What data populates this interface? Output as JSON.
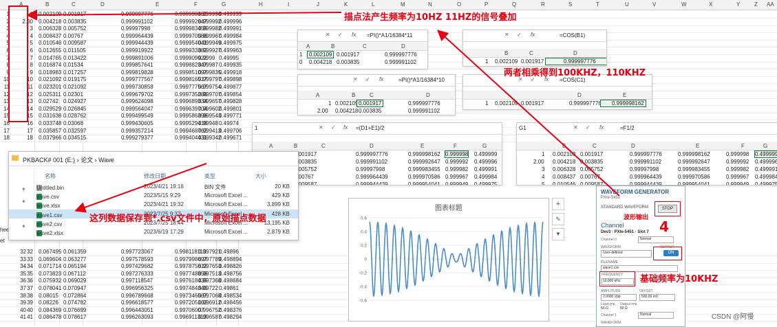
{
  "sheet": {
    "columns": [
      "A",
      "B",
      "C",
      "D",
      "E",
      "F",
      "G",
      "H",
      "I",
      "J",
      "K",
      "L",
      "M",
      "N",
      "O",
      "P",
      "Q",
      "R",
      "S",
      "T",
      "U",
      "V",
      "W",
      "X",
      "Y",
      "Z",
      "AA"
    ],
    "rows_top": [
      {
        "n": "1",
        "a": "1",
        "b": "0.002109",
        "c": "0.001917",
        "d": "0.999997776",
        "e": "0.999998162",
        "f": "0.999998",
        "g": "0.499999"
      },
      {
        "n": "2",
        "a": "2.00",
        "b": "0.004218",
        "c": "0.003835",
        "d": "0.999991102",
        "e": "0.999992647",
        "f": "0.999992",
        "g": "0.499996"
      },
      {
        "n": "3",
        "a": "3",
        "b": "0.006328",
        "c": "0.005752",
        "d": "0.99997998",
        "e": "0.999983455",
        "f": "0.999982",
        "g": "0.499991"
      },
      {
        "n": "4",
        "a": "4",
        "b": "0.008437",
        "c": "0.00767",
        "d": "0.999964439",
        "e": "0.999970586",
        "f": "0.999967",
        "g": "0.499984"
      },
      {
        "n": "5",
        "a": "5",
        "b": "0.010546",
        "c": "0.009587",
        "d": "0.999944439",
        "e": "0.999954041",
        "f": "0.999949",
        "g": "0.499975"
      },
      {
        "n": "6",
        "a": "6",
        "b": "0.012655",
        "c": "0.011505",
        "d": "0.999919922",
        "e": "0.999933382",
        "f": "0.999927",
        "g": "0.499963"
      },
      {
        "n": "7",
        "a": "7",
        "b": "0.014765",
        "c": "0.013422",
        "d": "0.999891006",
        "e": "0.999909922",
        "f": "0.9999",
        "g": "0.49995"
      },
      {
        "n": "8",
        "a": "8",
        "b": "0.016874",
        "c": "0.01534",
        "d": "0.999857641",
        "e": "0.999882347",
        "f": "0.99987",
        "g": "0.499935"
      },
      {
        "n": "9",
        "a": "9",
        "b": "0.018983",
        "c": "0.017257",
        "d": "0.999819828",
        "e": "0.999851097",
        "f": "0.999835",
        "g": "0.499918"
      },
      {
        "n": "10",
        "a": "10",
        "b": "0.021092",
        "c": "0.019175",
        "d": "0.999777567",
        "e": "0.999816517",
        "f": "0.999797",
        "g": "0.499898"
      },
      {
        "n": "11",
        "a": "11",
        "b": "0.023201",
        "c": "0.021092",
        "d": "0.999730858",
        "e": "0.999777567",
        "f": "0.999754",
        "g": "0.499877"
      },
      {
        "n": "12",
        "a": "12",
        "b": "0.025311",
        "c": "0.02301",
        "d": "0.999679702",
        "e": "0.999735288",
        "f": "0.999707",
        "g": "0.499854"
      },
      {
        "n": "13",
        "a": "13",
        "b": "0.02742",
        "c": "0.024927",
        "d": "0.999624098",
        "e": "0.999689334",
        "f": "0.999657",
        "g": "0.499828"
      },
      {
        "n": "14",
        "a": "14",
        "b": "0.029529",
        "c": "0.026845",
        "d": "0.999564047",
        "e": "0.999639704",
        "f": "0.999602",
        "g": "0.499801"
      },
      {
        "n": "15",
        "a": "15",
        "b": "0.031638",
        "c": "0.028762",
        "d": "0.999499549",
        "e": "0.999586398",
        "f": "0.999543",
        "g": "0.499771"
      },
      {
        "n": "16",
        "a": "16",
        "b": "0.033748",
        "c": "0.03068",
        "d": "0.999430605",
        "e": "0.999529418",
        "f": "0.99948",
        "g": "0.49974"
      },
      {
        "n": "17",
        "a": "17",
        "b": "0.035857",
        "c": "0.032597",
        "d": "0.999357214",
        "e": "0.999468762",
        "f": "0.999413",
        "g": "0.499706"
      },
      {
        "n": "18",
        "a": "18",
        "b": "0.037966",
        "c": "0.034515",
        "d": "0.999279377",
        "e": "0.999404431",
        "f": "0.999342",
        "g": "0.499671"
      }
    ],
    "rows_bottom": [
      {
        "n": "32",
        "a": "32",
        "b": "0.067495",
        "c": "0.061359",
        "d": "0.997723067",
        "e": "0.998118113",
        "f": "0.997921",
        "g": "0.49896"
      },
      {
        "n": "33",
        "a": "33",
        "b": "0.069604",
        "c": "0.063277",
        "d": "0.997578593",
        "e": "0.997998697",
        "f": "0.997789",
        "g": "0.498894"
      },
      {
        "n": "34",
        "a": "34",
        "b": "0.071714",
        "c": "0.065194",
        "d": "0.997429682",
        "e": "0.997875612",
        "f": "0.997653",
        "g": "0.498826"
      },
      {
        "n": "35",
        "a": "35",
        "b": "0.073823",
        "c": "0.067112",
        "d": "0.997276333",
        "e": "0.997748858",
        "f": "0.997513",
        "g": "0.498756"
      },
      {
        "n": "36",
        "a": "36",
        "b": "0.075932",
        "c": "0.069029",
        "d": "0.997118547",
        "e": "0.997618435",
        "f": "0.997368",
        "g": "0.498684"
      },
      {
        "n": "37",
        "a": "37",
        "b": "0.078041",
        "c": "0.070947",
        "d": "0.996956325",
        "e": "0.997484345",
        "f": "0.99722",
        "g": "0.49861"
      },
      {
        "n": "38",
        "a": "38",
        "b": "0.08015",
        "c": "0.072864",
        "d": "0.996789668",
        "e": "0.997346587",
        "f": "0.997068",
        "g": "0.498534"
      },
      {
        "n": "39",
        "a": "39",
        "b": "0.08226",
        "c": "0.074782",
        "d": "0.996618577",
        "e": "0.997205162",
        "f": "0.996912",
        "g": "0.498456"
      },
      {
        "n": "40",
        "a": "40",
        "b": "0.084369",
        "c": "0.076699",
        "d": "0.996443051",
        "e": "0.99706007",
        "f": "0.996752",
        "g": "0.498376"
      },
      {
        "n": "41",
        "a": "41",
        "b": "0.086478",
        "c": "0.078617",
        "d": "0.996263093",
        "e": "0.996911313",
        "f": "0.996587",
        "g": "0.498294"
      }
    ],
    "side_labels": [
      "heet",
      "et"
    ]
  },
  "annotations": {
    "top": "描点法产生频率为10HZ   11HZ的信号叠加",
    "mid": "两者相乘得到100KHZ，110KHZ",
    "file": "这列数据保存到*.csv文件中，原始描点数据",
    "wave_out": "波形输出",
    "four": "4",
    "base": "基础频率为10KHZ"
  },
  "formula_bars": {
    "b1": {
      "name": "",
      "formula": "=PI()*A1/16384*11"
    },
    "d1": {
      "name": "",
      "formula": "=COS(B1)"
    },
    "c1": {
      "name": "",
      "formula": "=PI()*A1/16384*10"
    },
    "e1": {
      "name": "",
      "formula": "=COS(C1)"
    },
    "f1": {
      "name": "1",
      "formula": "=(D1+E1)/2"
    },
    "g1": {
      "name": "G1",
      "formula": "=F1/2"
    }
  },
  "popups": {
    "b1": {
      "rows": [
        [
          "1",
          "0.002109",
          "0.001917",
          "",
          "0.999997776"
        ],
        [
          "0",
          "0.004218",
          "0.003835",
          "",
          "0.999991102"
        ]
      ]
    },
    "d1": {
      "row": [
        "1",
        "0.002109",
        "0.001917",
        "0.999997776"
      ]
    },
    "c1": {
      "rows": [
        [
          "1",
          "0.002109",
          "0.001917",
          "",
          "0.999997776"
        ],
        [
          "2.00",
          "0.004218",
          "0.003835",
          "",
          "0.999991102"
        ]
      ]
    },
    "e1": {
      "row": [
        "1",
        "0.002109",
        "0.001917",
        "0.999997776",
        "0.999998162"
      ]
    },
    "f1": {
      "rows": [
        [
          "",
          "0.002109",
          "0.001917",
          "0.999997776",
          "0.999998162",
          "0.999998",
          "0.499999"
        ],
        [
          "",
          "0.004218",
          "0.003835",
          "0.999991102",
          "0.999992647",
          "0.999992",
          "0.499996"
        ],
        [
          "",
          "0.006328",
          "0.005752",
          "0.99997998",
          "0.999983455",
          "0.999982",
          "0.499991"
        ],
        [
          "",
          "0.008437",
          "0.00767",
          "0.999964439",
          "0.999970586",
          "0.999967",
          "0.499984"
        ],
        [
          "",
          "0.010546",
          "0.009587",
          "0.999944439",
          "0.999954041",
          "0.999949",
          "0.499975"
        ]
      ]
    },
    "g1": {
      "rows": [
        [
          "1",
          "0.002109",
          "0.001917",
          "0.999997776",
          "0.999998162",
          "0.999998",
          "0.499999"
        ],
        [
          "2.00",
          "0.004218",
          "0.003835",
          "0.999991102",
          "0.999992647",
          "0.999992",
          "0.499996"
        ],
        [
          "3",
          "0.006328",
          "0.005752",
          "0.99997998",
          "0.999983455",
          "0.999982",
          "0.499991"
        ],
        [
          "4",
          "0.008437",
          "0.00767",
          "0.999964439",
          "0.999970586",
          "0.999967",
          "0.499984"
        ],
        [
          "5",
          "0.010546",
          "0.009587",
          "0.999944439",
          "0.999954041",
          "0.999949",
          "0.499975"
        ]
      ]
    }
  },
  "explorer": {
    "path": [
      "PKBACK# 001 (E:)",
      "论文",
      "Wave"
    ],
    "headers": {
      "name": "名称",
      "date": "修改日期",
      "type": "类型",
      "size": "大小"
    },
    "files": [
      {
        "name": "Untitled.bin",
        "date": "2023/4/21 19:16",
        "type": "BIN 文件",
        "size": "20 KB"
      },
      {
        "name": "wave.csv",
        "date": "2023/5/15 9:29",
        "type": "Microsoft Excel ...",
        "size": "429 KB"
      },
      {
        "name": "wave.xlsx",
        "date": "2023/4/21 19:32",
        "type": "Microsoft Excel ...",
        "size": "3,899 KB"
      },
      {
        "name": "wave1.csv",
        "date": "2023/7/25 9:37",
        "type": "Microsoft Excel ...",
        "size": "428 KB"
      },
      {
        "name": "wave2.csv",
        "date": "2023/7/25 18:44",
        "type": "Microsoft Excel ...",
        "size": "13,195 KB"
      },
      {
        "name": "wave2.xlsx",
        "date": "2023/6/19 17:29",
        "type": "Microsoft Excel ...",
        "size": "2,879 KB"
      }
    ]
  },
  "chart_data": {
    "type": "line",
    "title": "图表标题",
    "ylim": [
      -0.6,
      0.6
    ],
    "yticks": [
      "0.6",
      "0.4",
      "0.2",
      "0",
      "-0.2",
      "-0.4",
      "-0.6"
    ],
    "series": [
      {
        "name": "",
        "color": "#4a8bc9",
        "envelope": "abs(cos)",
        "inner_cycles": 21
      }
    ],
    "grid": true
  },
  "chart_tools": [
    "+",
    "✎",
    "▼"
  ],
  "wavegen": {
    "title": "WAVEFORM GENERATOR",
    "model": "PXIe-5451",
    "std": "STANDARD WAVEFORM",
    "stop": "STOP",
    "channel": "Channel",
    "dev": "Dev3 · PXIe-5451 · Slot 7",
    "ch0": "Channel 0",
    "normal": "Normal",
    "waveform": "WAVEFORM",
    "output": "OUTPUT",
    "userdef": "User-defined",
    "on": "ON",
    "filename": "FILENAME",
    "file": "wave1.csv",
    "frequency": "FREQUENCY",
    "freq_val": "10,000 kHz",
    "amplitude": "AMPLITUDE",
    "offset": "OFFSET",
    "amp_val": "2.0000 Vpp",
    "off_val": "500.00 mV",
    "load": "Load imp.",
    "outimp": "Output imp.",
    "load_val": "50 Ω",
    "out_val": "50 Ω",
    "ch1": "Channel 1",
    "normal2": "Normal",
    "waveform2": "WAVEFORM"
  },
  "watermark": "CSDN @阿慢",
  "colors": {
    "red": "#e60012",
    "green": "#217346",
    "wave": "#4a8bc9"
  }
}
